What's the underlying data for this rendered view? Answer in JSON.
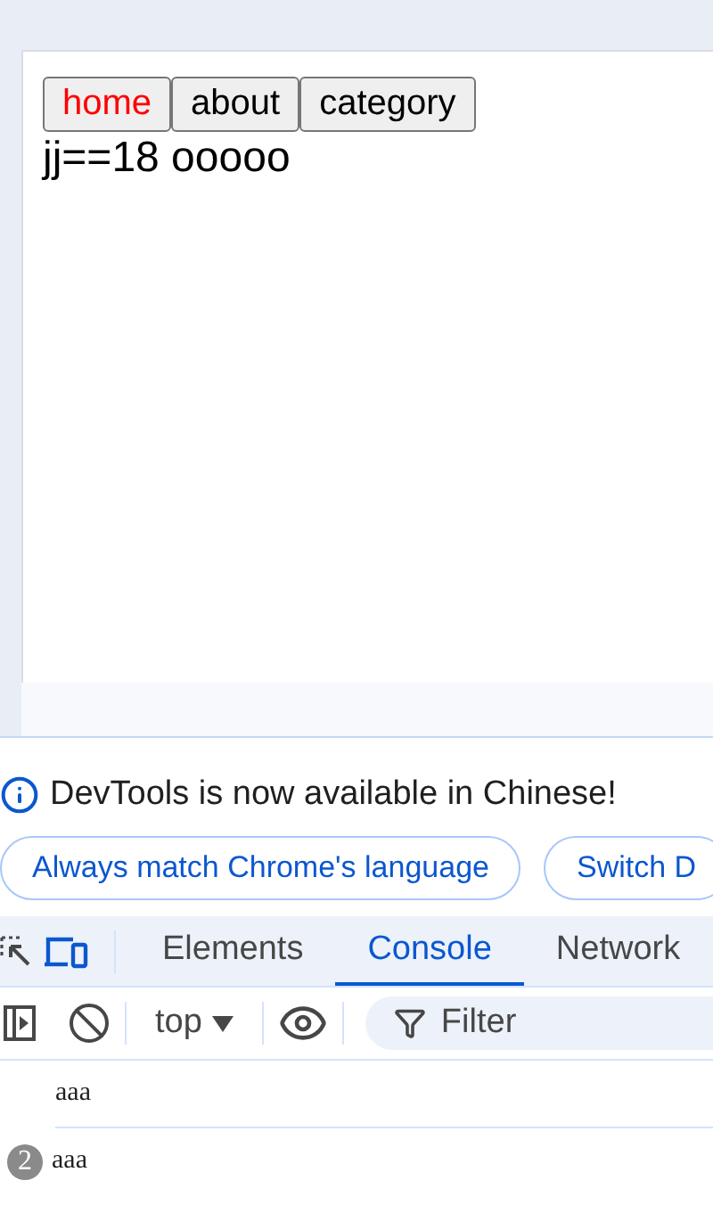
{
  "page": {
    "nav": [
      {
        "label": "home",
        "selected": true
      },
      {
        "label": "about",
        "selected": false
      },
      {
        "label": "category",
        "selected": false
      }
    ],
    "text": "jj==18 ooooo"
  },
  "devtools": {
    "notice": {
      "message": "DevTools is now available in Chinese!",
      "buttons": [
        "Always match Chrome's language",
        "Switch D"
      ]
    },
    "tabs": [
      {
        "label": "Elements",
        "selected": false
      },
      {
        "label": "Console",
        "selected": true
      },
      {
        "label": "Network",
        "selected": false
      }
    ],
    "console_toolbar": {
      "context": "top",
      "filter": {
        "placeholder": "Filter"
      }
    },
    "logs": [
      {
        "message": "aaa"
      },
      {
        "count": "2",
        "message": "aaa"
      }
    ]
  }
}
